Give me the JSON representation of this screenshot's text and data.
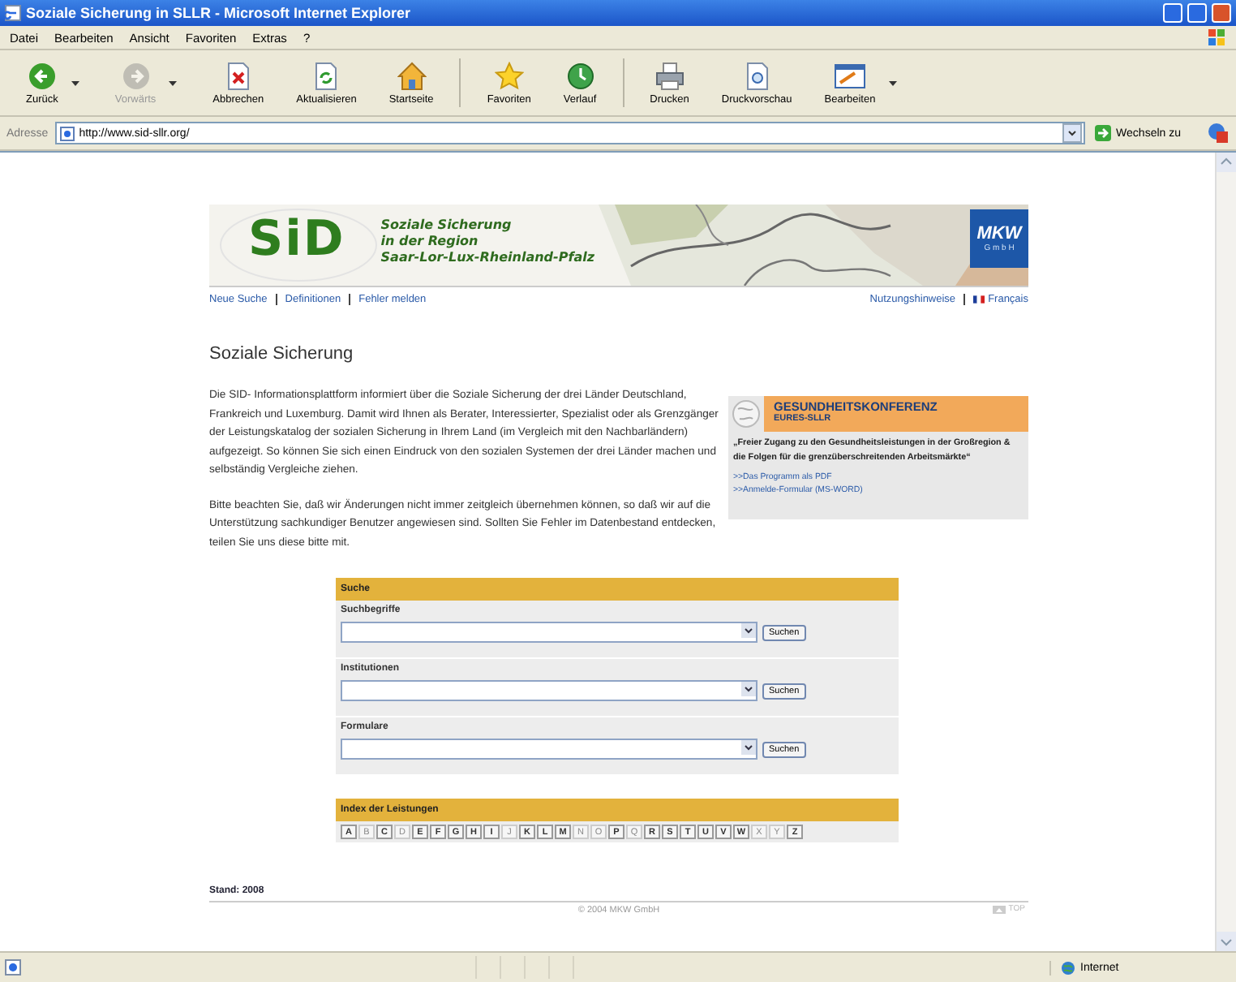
{
  "window": {
    "title": "Soziale Sicherung in SLLR - Microsoft Internet Explorer"
  },
  "menu": [
    "Datei",
    "Bearbeiten",
    "Ansicht",
    "Favoriten",
    "Extras",
    "?"
  ],
  "toolbar_groups": [
    {
      "buttons": [
        {
          "label": "Zurück",
          "kind": "back",
          "disabled": false,
          "caret": true
        },
        {
          "label": "Vorwärts",
          "kind": "forward",
          "disabled": true,
          "caret": true
        },
        {
          "label": "Abbrechen",
          "kind": "stop",
          "disabled": false,
          "caret": false
        },
        {
          "label": "Aktualisieren",
          "kind": "refresh",
          "disabled": false,
          "caret": false
        },
        {
          "label": "Startseite",
          "kind": "home",
          "disabled": false,
          "caret": false
        }
      ]
    },
    {
      "buttons": [
        {
          "label": "Favoriten",
          "kind": "star",
          "disabled": false,
          "caret": false
        },
        {
          "label": "Verlauf",
          "kind": "history",
          "disabled": false,
          "caret": false
        }
      ]
    },
    {
      "buttons": [
        {
          "label": "Drucken",
          "kind": "print",
          "disabled": false,
          "caret": false
        },
        {
          "label": "Druckvorschau",
          "kind": "preview",
          "disabled": false,
          "caret": false
        },
        {
          "label": "Bearbeiten",
          "kind": "edit",
          "disabled": false,
          "caret": true
        }
      ]
    }
  ],
  "address": {
    "label": "Adresse",
    "url": "http://www.sid-sllr.org/",
    "go": "Wechseln zu"
  },
  "page": {
    "logo": "SiD",
    "banner_lines": [
      "Soziale Sicherung",
      "in der Region",
      "Saar-Lor-Lux-Rheinland-Pfalz"
    ],
    "company": {
      "name": "MKW",
      "suffix": "G m b H"
    },
    "nav_left": [
      "Neue Suche",
      "Definitionen",
      "Fehler melden"
    ],
    "nav_right": [
      {
        "label": "Nutzungshinweise",
        "flag": false
      },
      {
        "label": "Français",
        "flag": true
      }
    ],
    "heading": "Soziale Sicherung",
    "paragraphs": [
      "Die SID- Informationsplattform informiert über die Soziale Sicherung der drei Länder Deutschland, Frankreich und Luxemburg. Damit wird Ihnen als Berater, Interessierter, Spezialist oder als Grenzgänger der Leistungskatalog der sozialen Sicherung in Ihrem Land (im Vergleich mit den Nachbarländern) aufgezeigt. So können Sie sich einen Eindruck von den sozialen Systemen der drei Länder machen und selbständig Vergleiche ziehen.",
      "Bitte beachten Sie, daß wir Änderungen nicht immer zeitgleich übernehmen können, so daß wir auf die Unterstützung sachkundiger Benutzer angewiesen sind. Sollten Sie Fehler im Datenbestand entdecken, teilen Sie uns diese bitte mit."
    ],
    "promo": {
      "title": "GESUNDHEITSKONFERENZ",
      "subtitle": "EURES-SLLR",
      "quote": "„Freier Zugang zu den Gesundheitsleistungen in der Großregion & die Folgen für die grenzüberschreitenden Arbeitsmärkte“",
      "links": [
        ">>Das Programm als PDF",
        ">>Anmelde-Formular (MS-WORD)"
      ]
    },
    "search": {
      "title": "Suche",
      "groups": [
        {
          "label": "Suchbegriffe",
          "button": "Suchen"
        },
        {
          "label": "Institutionen",
          "button": "Suchen"
        },
        {
          "label": "Formulare",
          "button": "Suchen"
        }
      ]
    },
    "index": {
      "title": "Index der Leistungen",
      "letters": [
        {
          "label": "A",
          "disabled": false
        },
        {
          "label": "B",
          "disabled": true
        },
        {
          "label": "C",
          "disabled": false
        },
        {
          "label": "D",
          "disabled": true
        },
        {
          "label": "E",
          "disabled": false
        },
        {
          "label": "F",
          "disabled": false
        },
        {
          "label": "G",
          "disabled": false
        },
        {
          "label": "H",
          "disabled": false
        },
        {
          "label": "I",
          "disabled": false
        },
        {
          "label": "J",
          "disabled": true
        },
        {
          "label": "K",
          "disabled": false
        },
        {
          "label": "L",
          "disabled": false
        },
        {
          "label": "M",
          "disabled": false
        },
        {
          "label": "N",
          "disabled": true
        },
        {
          "label": "O",
          "disabled": true
        },
        {
          "label": "P",
          "disabled": false
        },
        {
          "label": "Q",
          "disabled": true
        },
        {
          "label": "R",
          "disabled": false
        },
        {
          "label": "S",
          "disabled": false
        },
        {
          "label": "T",
          "disabled": false
        },
        {
          "label": "U",
          "disabled": false
        },
        {
          "label": "V",
          "disabled": false
        },
        {
          "label": "W",
          "disabled": false
        },
        {
          "label": "X",
          "disabled": true
        },
        {
          "label": "Y",
          "disabled": true
        },
        {
          "label": "Z",
          "disabled": false
        }
      ]
    },
    "footer": {
      "stand": "Stand: 2008",
      "copyright": "© 2004 MKW GmbH",
      "top": "TOP"
    }
  },
  "status_bar": {
    "zone": "Internet"
  }
}
